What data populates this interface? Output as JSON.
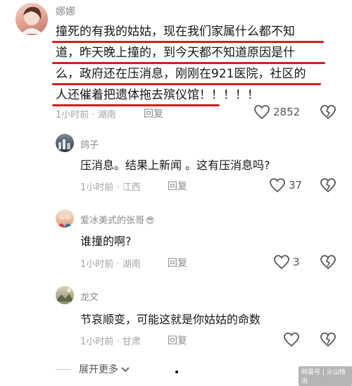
{
  "main_comment": {
    "username": "娜娜",
    "lines": [
      "撞死的有我的姑姑，现在我们家属什么都不知",
      "道，昨天晚上撞的，到今天都不知道原因是什",
      "么，政府还在压消息，刚刚在921医院，社区的",
      "人还催着把遗体拖去殡仪馆！！！！！"
    ],
    "time": "1小时前",
    "location": "湖南",
    "reply_label": "回复",
    "likes": "2852"
  },
  "replies": [
    {
      "username": "鸽子",
      "text": "压消息。结果上新闻 。这有压消息吗?",
      "time": "1小时前",
      "location": "江西",
      "reply_label": "回复",
      "likes": "37"
    },
    {
      "username": "爱冰美式的张哥",
      "emoji": "😎",
      "text": "谁撞的啊?",
      "time": "1小时前",
      "location": "湖南",
      "reply_label": "回复",
      "likes": "3"
    },
    {
      "username": "龙文",
      "text": "节哀顺变，可能这就是你姑姑的命数",
      "time": "1小时前",
      "location": "甘肃",
      "reply_label": "回复",
      "likes": ""
    }
  ],
  "expand_label": "展开更多",
  "separator": "·",
  "watermark": "网易号 | 火山特讯",
  "colors": {
    "annotation": "#d41f1f",
    "meta": "#a3a3a3"
  }
}
